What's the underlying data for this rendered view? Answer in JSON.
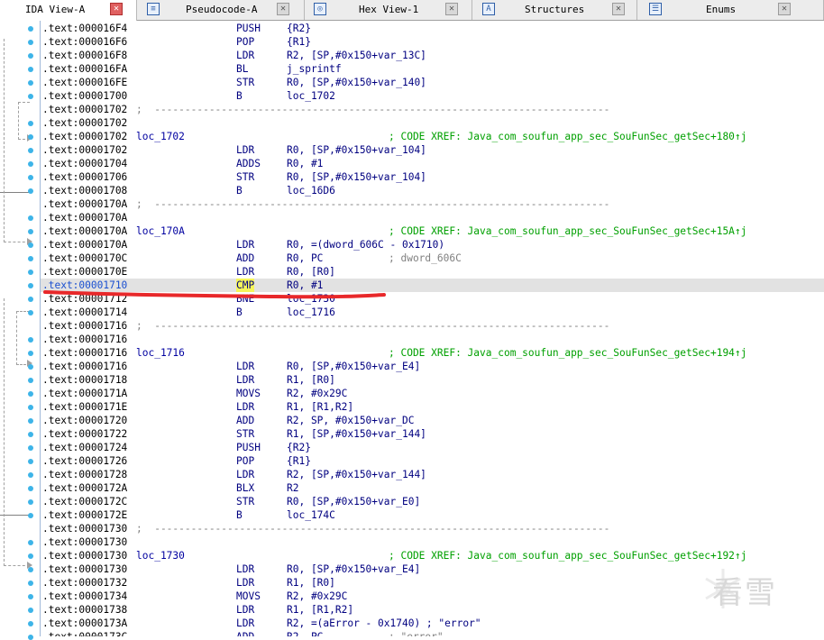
{
  "tabs": [
    {
      "label": "IDA View-A",
      "icon": "ida-view-icon",
      "active": true
    },
    {
      "label": "Pseudocode-A",
      "icon": "pseudocode-icon",
      "active": false
    },
    {
      "label": "Hex View-1",
      "icon": "hex-view-icon",
      "active": false
    },
    {
      "label": "Structures",
      "icon": "structures-icon",
      "active": false
    },
    {
      "label": "Enums",
      "icon": "enums-icon",
      "active": false
    }
  ],
  "close_glyph": "✕",
  "separator": ";  ---------------------------------------------------------------------------",
  "lines": [
    {
      "addr": ".text:000016F4",
      "mnem": "PUSH",
      "ops": "{R2}"
    },
    {
      "addr": ".text:000016F6",
      "mnem": "POP",
      "ops": "{R1}"
    },
    {
      "addr": ".text:000016F8",
      "mnem": "LDR",
      "ops": "R2, [SP,#0x150+var_13C]"
    },
    {
      "addr": ".text:000016FA",
      "mnem": "BL",
      "ops": "j_sprintf"
    },
    {
      "addr": ".text:000016FE",
      "mnem": "STR",
      "ops": "R0, [SP,#0x150+var_140]"
    },
    {
      "addr": ".text:00001700",
      "mnem": "B",
      "ops": "loc_1702"
    },
    {
      "addr": ".text:00001702",
      "sep": true
    },
    {
      "addr": ".text:00001702"
    },
    {
      "addr": ".text:00001702",
      "label": "loc_1702",
      "cmt": "; CODE XREF: Java_com_soufun_app_sec_SouFunSec_getSec+180↑j"
    },
    {
      "addr": ".text:00001702",
      "mnem": "LDR",
      "ops": "R0, [SP,#0x150+var_104]"
    },
    {
      "addr": ".text:00001704",
      "mnem": "ADDS",
      "ops": "R0, #1"
    },
    {
      "addr": ".text:00001706",
      "mnem": "STR",
      "ops": "R0, [SP,#0x150+var_104]"
    },
    {
      "addr": ".text:00001708",
      "mnem": "B",
      "ops": "loc_16D6"
    },
    {
      "addr": ".text:0000170A",
      "sep": true
    },
    {
      "addr": ".text:0000170A"
    },
    {
      "addr": ".text:0000170A",
      "label": "loc_170A",
      "cmt": "; CODE XREF: Java_com_soufun_app_sec_SouFunSec_getSec+15A↑j"
    },
    {
      "addr": ".text:0000170A",
      "mnem": "LDR",
      "ops": "R0, =(dword_606C - 0x1710)"
    },
    {
      "addr": ".text:0000170C",
      "mnem": "ADD",
      "ops": "R0, PC",
      "gcmt": "; dword_606C"
    },
    {
      "addr": ".text:0000170E",
      "mnem": "LDR",
      "ops": "R0, [R0]"
    },
    {
      "addr": ".text:00001710",
      "mnem": "CMP",
      "ops": "R0, #1",
      "highlight": true
    },
    {
      "addr": ".text:00001712",
      "mnem": "BNE",
      "ops": "loc_1730"
    },
    {
      "addr": ".text:00001714",
      "mnem": "B",
      "ops": "loc_1716"
    },
    {
      "addr": ".text:00001716",
      "sep": true
    },
    {
      "addr": ".text:00001716"
    },
    {
      "addr": ".text:00001716",
      "label": "loc_1716",
      "cmt": "; CODE XREF: Java_com_soufun_app_sec_SouFunSec_getSec+194↑j"
    },
    {
      "addr": ".text:00001716",
      "mnem": "LDR",
      "ops": "R0, [SP,#0x150+var_E4]"
    },
    {
      "addr": ".text:00001718",
      "mnem": "LDR",
      "ops": "R1, [R0]"
    },
    {
      "addr": ".text:0000171A",
      "mnem": "MOVS",
      "ops": "R2, #0x29C"
    },
    {
      "addr": ".text:0000171E",
      "mnem": "LDR",
      "ops": "R1, [R1,R2]"
    },
    {
      "addr": ".text:00001720",
      "mnem": "ADD",
      "ops": "R2, SP, #0x150+var_DC"
    },
    {
      "addr": ".text:00001722",
      "mnem": "STR",
      "ops": "R1, [SP,#0x150+var_144]"
    },
    {
      "addr": ".text:00001724",
      "mnem": "PUSH",
      "ops": "{R2}"
    },
    {
      "addr": ".text:00001726",
      "mnem": "POP",
      "ops": "{R1}"
    },
    {
      "addr": ".text:00001728",
      "mnem": "LDR",
      "ops": "R2, [SP,#0x150+var_144]"
    },
    {
      "addr": ".text:0000172A",
      "mnem": "BLX",
      "ops": "R2"
    },
    {
      "addr": ".text:0000172C",
      "mnem": "STR",
      "ops": "R0, [SP,#0x150+var_E0]"
    },
    {
      "addr": ".text:0000172E",
      "mnem": "B",
      "ops": "loc_174C"
    },
    {
      "addr": ".text:00001730",
      "sep": true
    },
    {
      "addr": ".text:00001730"
    },
    {
      "addr": ".text:00001730",
      "label": "loc_1730",
      "cmt": "; CODE XREF: Java_com_soufun_app_sec_SouFunSec_getSec+192↑j"
    },
    {
      "addr": ".text:00001730",
      "mnem": "LDR",
      "ops": "R0, [SP,#0x150+var_E4]"
    },
    {
      "addr": ".text:00001732",
      "mnem": "LDR",
      "ops": "R1, [R0]"
    },
    {
      "addr": ".text:00001734",
      "mnem": "MOVS",
      "ops": "R2, #0x29C"
    },
    {
      "addr": ".text:00001738",
      "mnem": "LDR",
      "ops": "R1, [R1,R2]"
    },
    {
      "addr": ".text:0000173A",
      "mnem": "LDR",
      "ops": "R2, =(aError - 0x1740) ; \"error\""
    },
    {
      "addr": ".text:0000173C",
      "mnem": "ADD",
      "ops": "R2, PC",
      "gcmt": "; \"error\""
    }
  ],
  "watermark": "看雪",
  "colors": {
    "address": "#000000",
    "label": "#0000a0",
    "instruction": "#000080",
    "xref_comment": "#00a000",
    "highlight_row": "#e2e2e2",
    "highlight_mnemonic": "#f5f55a",
    "annotation_stroke": "#e8282a",
    "breakpoint_dot": "#3db4e8"
  }
}
